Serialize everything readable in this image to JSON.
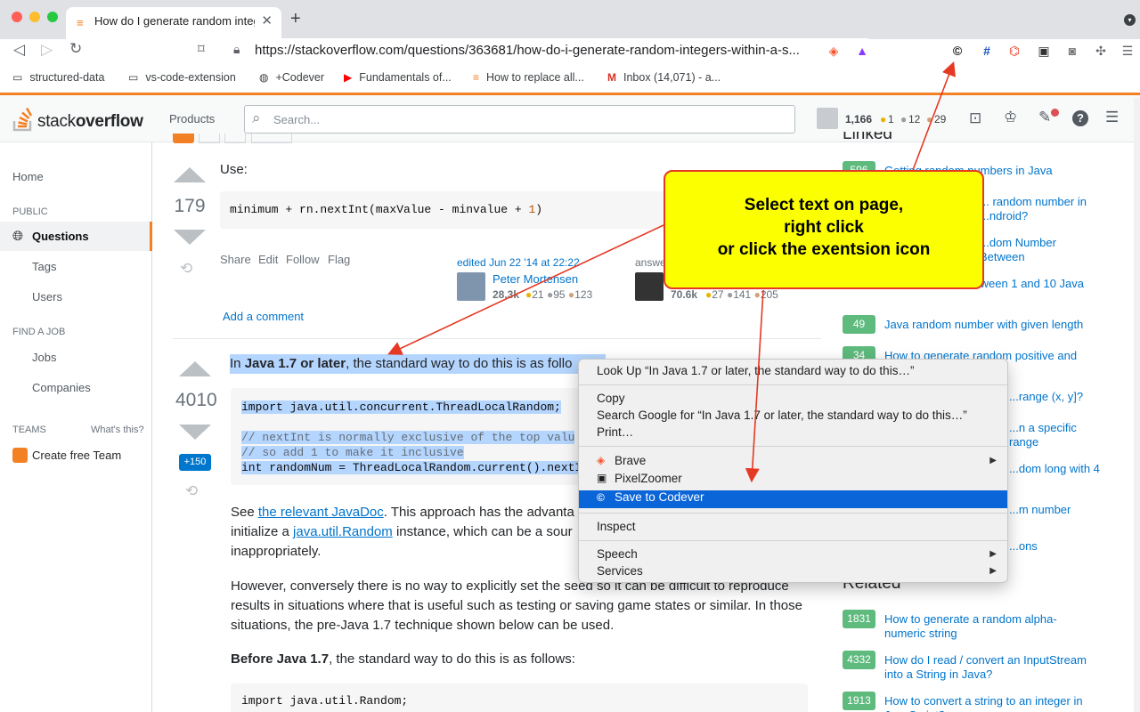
{
  "browser": {
    "tab_title": "How do I generate random integ",
    "url": "https://stackoverflow.com/questions/363681/how-do-i-generate-random-integers-within-a-s...",
    "bookmarks": [
      "structured-data",
      "vs-code-extension",
      "+Codever",
      "Fundamentals of...",
      "How to replace all...",
      "Inbox (14,071) - a..."
    ]
  },
  "topbar": {
    "logo_plain": "stack",
    "logo_bold": "overflow",
    "products": "Products",
    "search_placeholder": "Search...",
    "reputation": "1,166",
    "gold": "1",
    "silver": "12",
    "bronze": "29"
  },
  "sidebar": {
    "home": "Home",
    "public": "PUBLIC",
    "questions": "Questions",
    "tags": "Tags",
    "users": "Users",
    "find_job": "FIND A JOB",
    "jobs": "Jobs",
    "companies": "Companies",
    "teams": "TEAMS",
    "whats_this": "What's this?",
    "create_team": "Create free Team"
  },
  "answer1": {
    "use_label": "Use:",
    "votes": "179",
    "code": "minimum + rn.nextInt(maxValue - minvalue + ",
    "code_num": "1",
    "code_end": ")",
    "actions": [
      "Share",
      "Edit",
      "Follow",
      "Flag"
    ],
    "edited": "edited Jun 22 '14 at 22:22",
    "editor": "Peter Mortensen",
    "editor_rep": "28.3k",
    "editor_badges": [
      "21",
      "95",
      "123"
    ],
    "answered": "answe",
    "answerer_rep": "70.6k",
    "answerer_badges": [
      "27",
      "141",
      "205"
    ],
    "add_comment": "Add a comment"
  },
  "answer2": {
    "votes": "4010",
    "bounty": "+150",
    "intro_pre": "In ",
    "intro_bold": "Java 1.7 or later",
    "intro_post": ", the standard way to do this is as follo",
    "code_lines": [
      "import java.util.concurrent.ThreadLocalRandom;",
      "",
      "// nextInt is normally exclusive of the top valu",
      "// so add 1 to make it inclusive",
      "int randomNum = ThreadLocalRandom.current().nextI"
    ],
    "p1_a": "See ",
    "p1_link": "the relevant JavaDoc",
    "p1_b": ". This approach has the advanta",
    "p1_c": "initialize a ",
    "p1_link2": "java.util.Random",
    "p1_d": " instance, which can be a sour",
    "p1_e": "inappropriately.",
    "p2": "However, conversely there is no way to explicitly set the seed so it can be difficult to reproduce results in situations where that is useful such as testing or saving game states or similar. In those situations, the pre-Java 1.7 technique shown below can be used.",
    "p3_bold": "Before Java 1.7",
    "p3_rest": ", the standard way to do this is as follows:",
    "code2": "import java.util.Random;"
  },
  "right": {
    "linked_heading": "Linked",
    "linked": [
      {
        "count": "596",
        "text": "Getting random numbers in Java"
      },
      {
        "count": "",
        "text": "... random number in ...ndroid?"
      },
      {
        "count": "",
        "text": "...dom Number Between"
      },
      {
        "count": "",
        "text": "...dom Number between 1 and 10 Java"
      },
      {
        "count": "49",
        "text": "Java random number with given length"
      },
      {
        "count": "34",
        "text": "How to generate random positive and ...ava"
      },
      {
        "count": "",
        "text": "...range (x, y]?"
      },
      {
        "count": "",
        "text": "...n a specific range"
      },
      {
        "count": "",
        "text": "...dom long with 4"
      },
      {
        "count": "",
        "text": "...m number"
      },
      {
        "count": "",
        "text": "...ons"
      }
    ],
    "related_heading": "Related",
    "related": [
      {
        "count": "1831",
        "text": "How to generate a random alpha-numeric string"
      },
      {
        "count": "4332",
        "text": "How do I read / convert an InputStream into a String in Java?"
      },
      {
        "count": "1913",
        "text": "How to convert a string to an integer in JavaScript?"
      }
    ]
  },
  "callout": {
    "line1": "Select text on page,",
    "line2": "right click",
    "line3": "or click the exentsion icon"
  },
  "context_menu": {
    "lookup": "Look Up “In Java 1.7 or later, the standard way to do this…”",
    "copy": "Copy",
    "search_google": "Search Google for “In Java 1.7 or later, the standard way to do this…”",
    "print": "Print…",
    "brave": "Brave",
    "pixelzoomer": "PixelZoomer",
    "save_codever": "Save to Codever",
    "inspect": "Inspect",
    "speech": "Speech",
    "services": "Services"
  },
  "colors": {
    "so_orange": "#f48024",
    "link_blue": "#0074cc",
    "accepted_green": "#5eba7d",
    "menu_highlight": "#0a65d8",
    "callout_yellow": "#fbff00",
    "annotation_red": "#e53923"
  }
}
